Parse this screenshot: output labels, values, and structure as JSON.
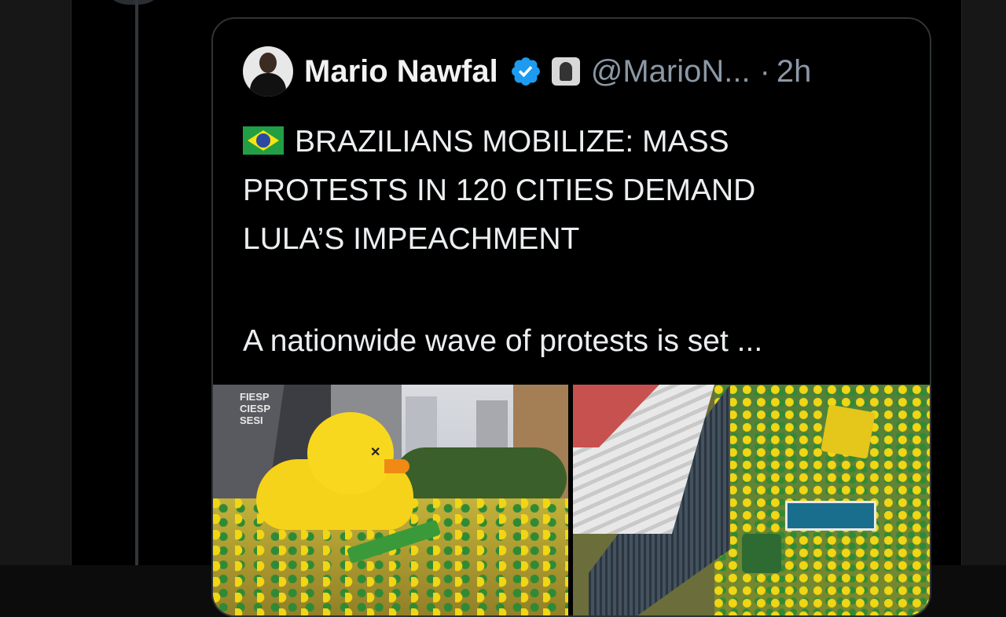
{
  "quoted_post": {
    "author_name": "Mario Nawfal",
    "handle": "@MarioN...",
    "separator": "·",
    "time": "2h",
    "text_lines": [
      "BRAZILIANS MOBILIZE: MASS",
      "PROTESTS IN 120 CITIES DEMAND",
      "LULA’S IMPEACHMENT"
    ],
    "summary": "A nationwide wave of protests is set ...",
    "image_left_sign": "FIESP\nCIESP\nSESI",
    "media_count": 2
  },
  "colors": {
    "background": "#000000",
    "card_border": "#2f3336",
    "secondary_text": "#8b98a5",
    "verified_blue": "#1d9bf0"
  },
  "icons": {
    "verified": "verified-badge-icon",
    "affiliate": "affiliate-badge-icon",
    "flag": "brazil-flag-icon"
  }
}
